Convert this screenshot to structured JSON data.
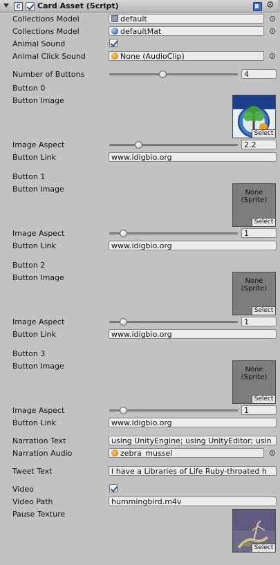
{
  "header": {
    "title": "Card Asset (Script)",
    "enabled": true,
    "script_icon_glyph": "C"
  },
  "fields": {
    "collections_model_1": {
      "label": "Collections Model",
      "value": "default",
      "icon": "mesh-icon"
    },
    "collections_model_2": {
      "label": "Collections Model",
      "value": "defaultMat",
      "icon": "sphere-icon"
    },
    "animal_sound": {
      "label": "Animal Sound",
      "checked": true
    },
    "animal_click_sound": {
      "label": "Animal Click Sound",
      "value": "None (AudioClip)",
      "icon": "audio-icon"
    },
    "number_of_buttons": {
      "label": "Number of Buttons",
      "value": "4",
      "slider_fraction": 0.41
    }
  },
  "buttons": [
    {
      "heading": "Button 0",
      "image_label": "Button Image",
      "image_kind": "image",
      "aspect_label": "Image Aspect",
      "aspect_value": "2.2",
      "aspect_fraction": 0.22,
      "link_label": "Button Link",
      "link_value": "www.idigbio.org",
      "select_label": "Select"
    },
    {
      "heading": "Button 1",
      "image_label": "Button Image",
      "image_kind": "none",
      "none_text": "None\n(Sprite)",
      "aspect_label": "Image Aspect",
      "aspect_value": "1",
      "aspect_fraction": 0.1,
      "link_label": "Button Link",
      "link_value": "www.idigbio.org",
      "select_label": "Select"
    },
    {
      "heading": "Button 2",
      "image_label": "Button Image",
      "image_kind": "none",
      "none_text": "None\n(Sprite)",
      "aspect_label": "Image Aspect",
      "aspect_value": "1",
      "aspect_fraction": 0.1,
      "link_label": "Button Link",
      "link_value": "www.idigbio.org",
      "select_label": "Select"
    },
    {
      "heading": "Button 3",
      "image_label": "Button Image",
      "image_kind": "none",
      "none_text": "None\n(Sprite)",
      "aspect_label": "Image Aspect",
      "aspect_value": "1",
      "aspect_fraction": 0.1,
      "link_label": "Button Link",
      "link_value": "www.idigbio.org",
      "select_label": "Select"
    }
  ],
  "narration": {
    "text_label": "Narration Text",
    "text_value": "using UnityEngine; using UnityEditor; usin",
    "audio_label": "Narration Audio",
    "audio_value": "zebra_mussel",
    "audio_icon": "audio-icon"
  },
  "tweet": {
    "label": "Tweet Text",
    "value": "I have a Libraries of Life Ruby-throated h"
  },
  "video": {
    "label": "Video",
    "checked": true,
    "path_label": "Video Path",
    "path_value": "hummingbird.m4v",
    "pause_label": "Pause Texture",
    "select_label": "Select"
  },
  "colors": {
    "panel_bg": "#c2c2c2",
    "field_bg": "#ececec",
    "accent_check": "#2a4f8a"
  }
}
